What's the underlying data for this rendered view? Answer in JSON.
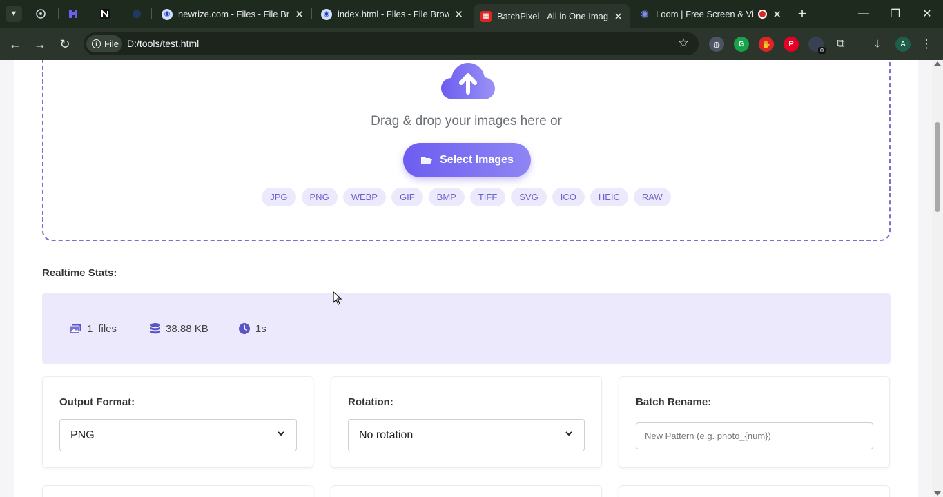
{
  "browser": {
    "tabs": [
      {
        "title": "newrize.com - Files - File Brow",
        "active": false
      },
      {
        "title": "index.html - Files - File Browse",
        "active": false
      },
      {
        "title": "BatchPixel - All in One Image C",
        "active": true
      },
      {
        "title": "Loom | Free Screen & Vide",
        "active": false
      }
    ],
    "address": {
      "scheme_label": "File",
      "url": "D:/tools/test.html"
    },
    "profile_initial": "A",
    "extension_badge": "0"
  },
  "upload": {
    "prompt": "Drag & drop your images here or",
    "button_label": "Select Images",
    "formats": [
      "JPG",
      "PNG",
      "WEBP",
      "GIF",
      "BMP",
      "TIFF",
      "SVG",
      "ICO",
      "HEIC",
      "RAW"
    ]
  },
  "stats": {
    "label": "Realtime Stats:",
    "files_count": "1",
    "files_unit": "files",
    "size": "38.88 KB",
    "time": "1s"
  },
  "options": {
    "output_format": {
      "label": "Output Format:",
      "value": "PNG"
    },
    "rotation": {
      "label": "Rotation:",
      "value": "No rotation"
    },
    "batch_rename": {
      "label": "Batch Rename:",
      "placeholder": "New Pattern (e.g. photo_{num})"
    }
  },
  "colors": {
    "accent": "#6d5df0",
    "accent_light": "#ebe9fb",
    "chrome_dark": "#1f2a1f"
  }
}
